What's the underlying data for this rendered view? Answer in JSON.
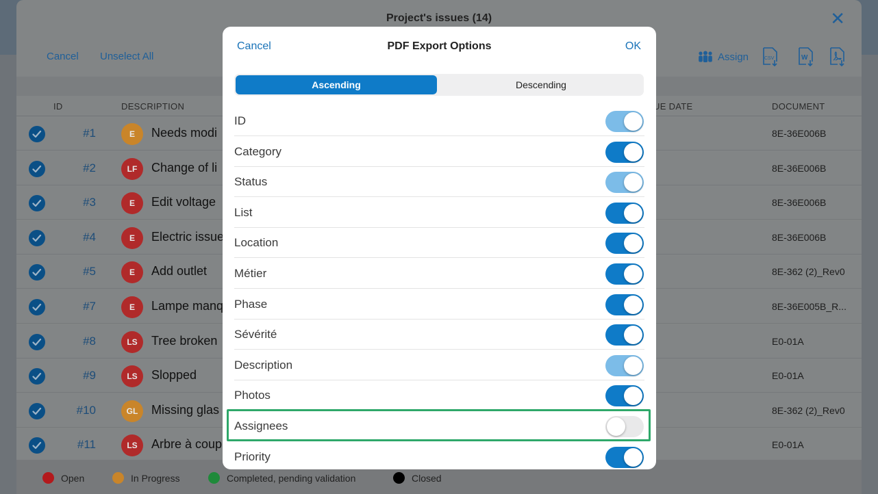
{
  "sheet": {
    "title": "Project's issues (14)",
    "cancel_label": "Cancel",
    "unselect_all_label": "Unselect All",
    "assign_label": "Assign",
    "export_icons": [
      "csv-export-icon",
      "word-export-icon",
      "pdf-export-icon"
    ]
  },
  "columns": {
    "id": "ID",
    "description": "DESCRIPTION",
    "due_date": "UE DATE",
    "document": "DOCUMENT"
  },
  "rows": [
    {
      "id": "#1",
      "initials": "E",
      "color": "#c9852a",
      "description": "Needs modi",
      "document": "8E-36E006B"
    },
    {
      "id": "#2",
      "initials": "LF",
      "color": "#b02a2a",
      "description": "Change of li",
      "document": "8E-36E006B"
    },
    {
      "id": "#3",
      "initials": "E",
      "color": "#b02a2a",
      "description": "Edit voltage",
      "document": "8E-36E006B"
    },
    {
      "id": "#4",
      "initials": "E",
      "color": "#b02a2a",
      "description": "Electric issue",
      "document": "8E-36E006B"
    },
    {
      "id": "#5",
      "initials": "E",
      "color": "#b02a2a",
      "description": "Add outlet",
      "document": "8E-362 (2)_Rev0"
    },
    {
      "id": "#7",
      "initials": "E",
      "color": "#b02a2a",
      "description": "Lampe manq",
      "document": "8E-36E005B_R..."
    },
    {
      "id": "#8",
      "initials": "LS",
      "color": "#b02a2a",
      "description": "Tree broken",
      "document": "E0-01A"
    },
    {
      "id": "#9",
      "initials": "LS",
      "color": "#b02a2a",
      "description": "Slopped",
      "document": "E0-01A"
    },
    {
      "id": "#10",
      "initials": "GL",
      "color": "#c9852a",
      "description": "Missing glas",
      "document": "8E-362 (2)_Rev0"
    },
    {
      "id": "#11",
      "initials": "LS",
      "color": "#b02a2a",
      "description": "Arbre à coup",
      "document": "E0-01A"
    }
  ],
  "legend": [
    {
      "label": "Open",
      "color": "#b3191c"
    },
    {
      "label": "In Progress",
      "color": "#c9852a"
    },
    {
      "label": "Completed, pending validation",
      "color": "#1f8a3a"
    },
    {
      "label": "Closed",
      "color": "#000000"
    }
  ],
  "modal": {
    "title": "PDF Export Options",
    "cancel_label": "Cancel",
    "ok_label": "OK",
    "sort": {
      "ascending": "Ascending",
      "descending": "Descending",
      "selected": "Ascending"
    },
    "options": [
      {
        "label": "ID",
        "state": "on-disabled"
      },
      {
        "label": "Category",
        "state": "on"
      },
      {
        "label": "Status",
        "state": "on-disabled"
      },
      {
        "label": "List",
        "state": "on"
      },
      {
        "label": "Location",
        "state": "on"
      },
      {
        "label": "Métier",
        "state": "on"
      },
      {
        "label": "Phase",
        "state": "on"
      },
      {
        "label": "Sévérité",
        "state": "on"
      },
      {
        "label": "Description",
        "state": "on-disabled"
      },
      {
        "label": "Photos",
        "state": "on"
      },
      {
        "label": "Assignees",
        "state": "off"
      },
      {
        "label": "Priority",
        "state": "on"
      }
    ],
    "highlighted_option": "Assignees"
  }
}
